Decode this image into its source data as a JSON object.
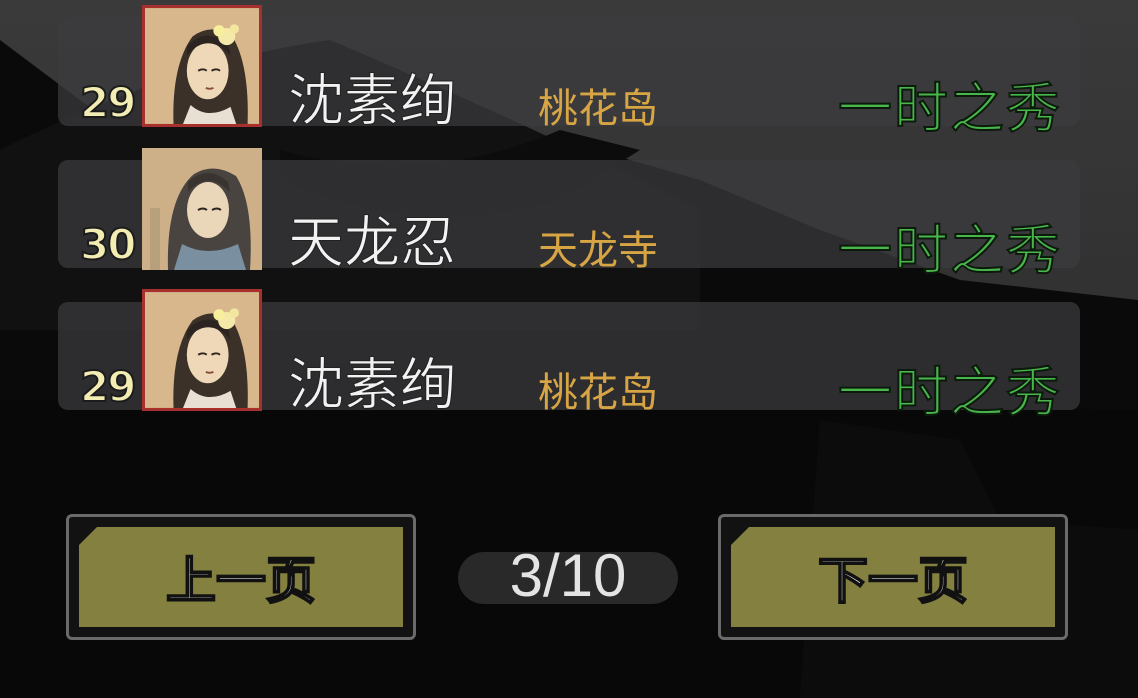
{
  "entries": [
    {
      "level": "29",
      "name": "沈素绚",
      "sect": "桃花岛",
      "rank": "一时之秀",
      "portrait_icon": "female-flower-portrait-icon"
    },
    {
      "level": "30",
      "name": "天龙忍",
      "sect": "天龙寺",
      "rank": "一时之秀",
      "portrait_icon": "male-monk-portrait-icon"
    },
    {
      "level": "29",
      "name": "沈素绚",
      "sect": "桃花岛",
      "rank": "一时之秀",
      "portrait_icon": "female-flower-portrait-icon"
    }
  ],
  "pagination": {
    "prev_label": "上一页",
    "next_label": "下一页",
    "page": "3/10"
  },
  "colors": {
    "name": "#f2f2f2",
    "sect": "#d8a544",
    "rank": "#49b64c",
    "level": "#f3ecb3",
    "button": "#848040",
    "portrait_border": "#a8302c"
  }
}
